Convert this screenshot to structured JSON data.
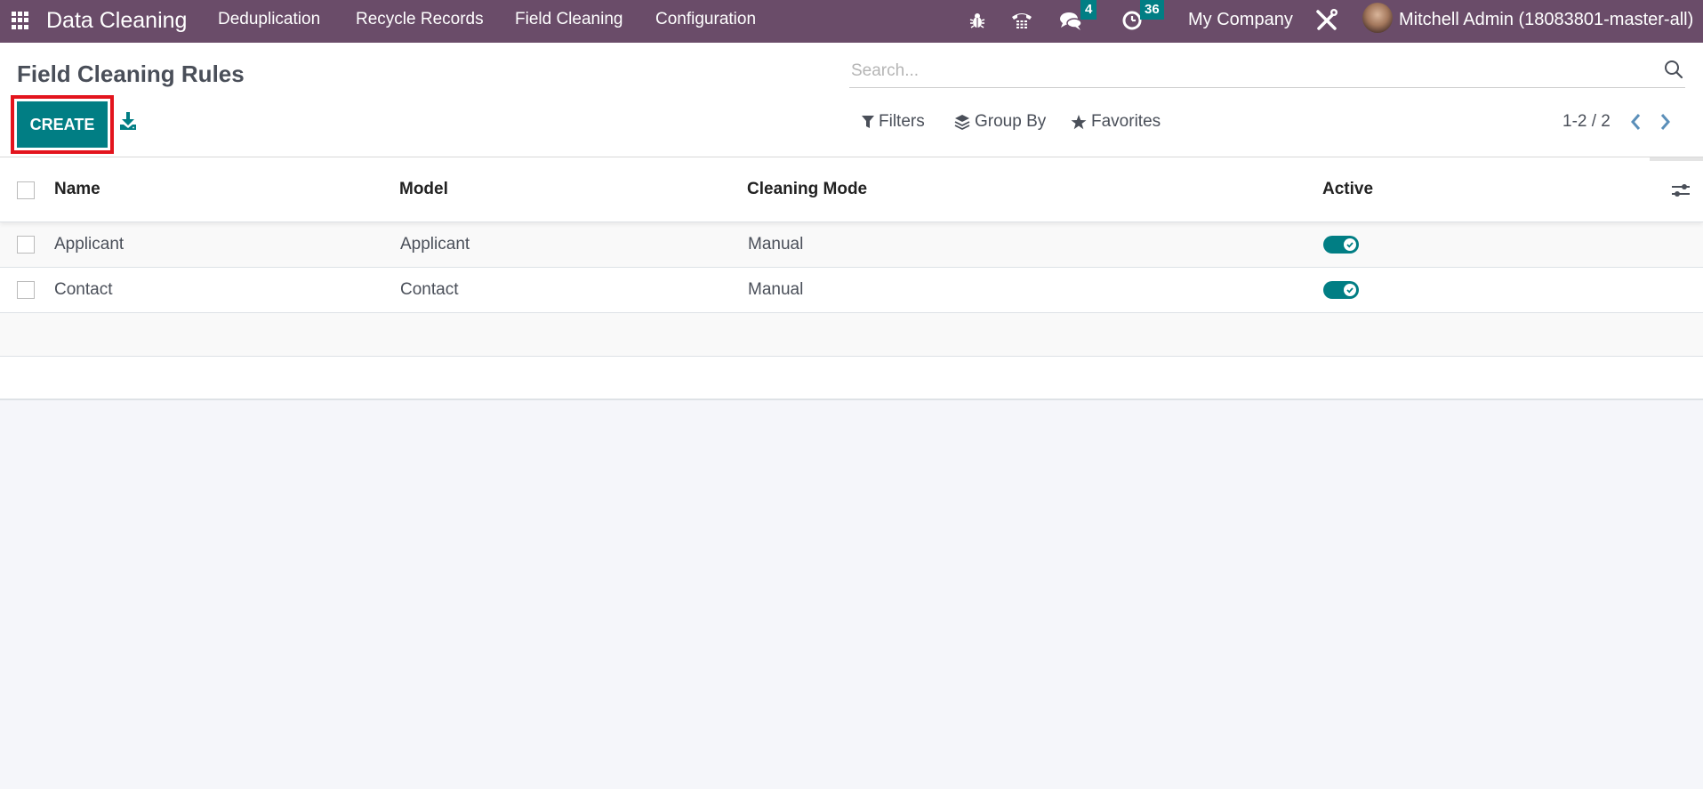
{
  "navbar": {
    "app_title": "Data Cleaning",
    "menu": [
      {
        "label": "Deduplication"
      },
      {
        "label": "Recycle Records"
      },
      {
        "label": "Field Cleaning"
      },
      {
        "label": "Configuration"
      }
    ],
    "icons": {
      "debug": "bug-icon",
      "voip": "phone-icon",
      "messages": "chat-icon",
      "activities": "clock-icon",
      "settings": "tools-icon"
    },
    "messages_count": "4",
    "activities_count": "36",
    "company": "My Company",
    "user": "Mitchell Admin (18083801-master-all)",
    "colors": {
      "navbar_bg": "#6a4c69",
      "badge_bg": "#017e84"
    }
  },
  "control_panel": {
    "title": "Field Cleaning Rules",
    "create_label": "CREATE",
    "search_placeholder": "Search...",
    "filters_label": "Filters",
    "group_by_label": "Group By",
    "favorites_label": "Favorites",
    "pager": "1-2 / 2",
    "colors": {
      "primary": "#017e84",
      "highlight": "#e3141d"
    }
  },
  "table": {
    "columns": [
      {
        "label": "Name"
      },
      {
        "label": "Model"
      },
      {
        "label": "Cleaning Mode"
      },
      {
        "label": "Active"
      }
    ],
    "rows": [
      {
        "name": "Applicant",
        "model": "Applicant",
        "cleaning_mode": "Manual",
        "active": true
      },
      {
        "name": "Contact",
        "model": "Contact",
        "cleaning_mode": "Manual",
        "active": true
      }
    ]
  }
}
